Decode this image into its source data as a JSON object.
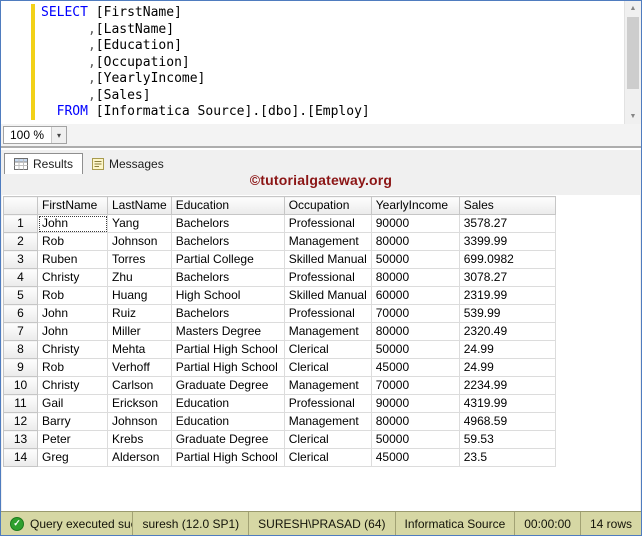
{
  "colors": {
    "keyword": "#0000ff",
    "watermark": "#8b1515",
    "statusbar": "#d6d7a4",
    "success": "#2ea02e"
  },
  "icons": {
    "check": "✓",
    "scroll_up": "▲",
    "scroll_down": "▼",
    "dropdown": "▾"
  },
  "editor": {
    "zoom": "100 %",
    "lines": [
      [
        {
          "t": "SELECT",
          "c": "kw"
        },
        {
          "t": " [FirstName]",
          "c": "id"
        }
      ],
      [
        {
          "t": "      ,",
          "c": "op"
        },
        {
          "t": "[LastName]",
          "c": "id"
        }
      ],
      [
        {
          "t": "      ,",
          "c": "op"
        },
        {
          "t": "[Education]",
          "c": "id"
        }
      ],
      [
        {
          "t": "      ,",
          "c": "op"
        },
        {
          "t": "[Occupation]",
          "c": "id"
        }
      ],
      [
        {
          "t": "      ,",
          "c": "op"
        },
        {
          "t": "[YearlyIncome]",
          "c": "id"
        }
      ],
      [
        {
          "t": "      ,",
          "c": "op"
        },
        {
          "t": "[Sales]",
          "c": "id"
        }
      ],
      [
        {
          "t": "  ",
          "c": "id"
        },
        {
          "t": "FROM",
          "c": "kw"
        },
        {
          "t": " [Informatica Source].[dbo].[Employ]",
          "c": "id"
        }
      ]
    ]
  },
  "results": {
    "tabs": [
      "Results",
      "Messages"
    ],
    "watermark": "©tutorialgateway.org",
    "columns": [
      "FirstName",
      "LastName",
      "Education",
      "Occupation",
      "YearlyIncome",
      "Sales"
    ],
    "focus_cell": [
      0,
      0
    ],
    "rows": [
      {
        "n": "1",
        "cells": [
          "John",
          "Yang",
          "Bachelors",
          "Professional",
          "90000",
          "3578.27"
        ]
      },
      {
        "n": "2",
        "cells": [
          "Rob",
          "Johnson",
          "Bachelors",
          "Management",
          "80000",
          "3399.99"
        ]
      },
      {
        "n": "3",
        "cells": [
          "Ruben",
          "Torres",
          "Partial College",
          "Skilled Manual",
          "50000",
          "699.0982"
        ]
      },
      {
        "n": "4",
        "cells": [
          "Christy",
          "Zhu",
          "Bachelors",
          "Professional",
          "80000",
          "3078.27"
        ]
      },
      {
        "n": "5",
        "cells": [
          "Rob",
          "Huang",
          "High School",
          "Skilled Manual",
          "60000",
          "2319.99"
        ]
      },
      {
        "n": "6",
        "cells": [
          "John",
          "Ruiz",
          "Bachelors",
          "Professional",
          "70000",
          "539.99"
        ]
      },
      {
        "n": "7",
        "cells": [
          "John",
          "Miller",
          "Masters Degree",
          "Management",
          "80000",
          "2320.49"
        ]
      },
      {
        "n": "8",
        "cells": [
          "Christy",
          "Mehta",
          "Partial High School",
          "Clerical",
          "50000",
          "24.99"
        ]
      },
      {
        "n": "9",
        "cells": [
          "Rob",
          "Verhoff",
          "Partial High School",
          "Clerical",
          "45000",
          "24.99"
        ]
      },
      {
        "n": "10",
        "cells": [
          "Christy",
          "Carlson",
          "Graduate Degree",
          "Management",
          "70000",
          "2234.99"
        ]
      },
      {
        "n": "11",
        "cells": [
          "Gail",
          "Erickson",
          "Education",
          "Professional",
          "90000",
          "4319.99"
        ]
      },
      {
        "n": "12",
        "cells": [
          "Barry",
          "Johnson",
          "Education",
          "Management",
          "80000",
          "4968.59"
        ]
      },
      {
        "n": "13",
        "cells": [
          "Peter",
          "Krebs",
          "Graduate Degree",
          "Clerical",
          "50000",
          "59.53"
        ]
      },
      {
        "n": "14",
        "cells": [
          "Greg",
          "Alderson",
          "Partial High School",
          "Clerical",
          "45000",
          "23.5"
        ]
      }
    ]
  },
  "status": {
    "items": [
      "Query executed successf...",
      "suresh (12.0 SP1)",
      "SURESH\\PRASAD (64)",
      "Informatica Source",
      "00:00:00",
      "14 rows"
    ]
  }
}
